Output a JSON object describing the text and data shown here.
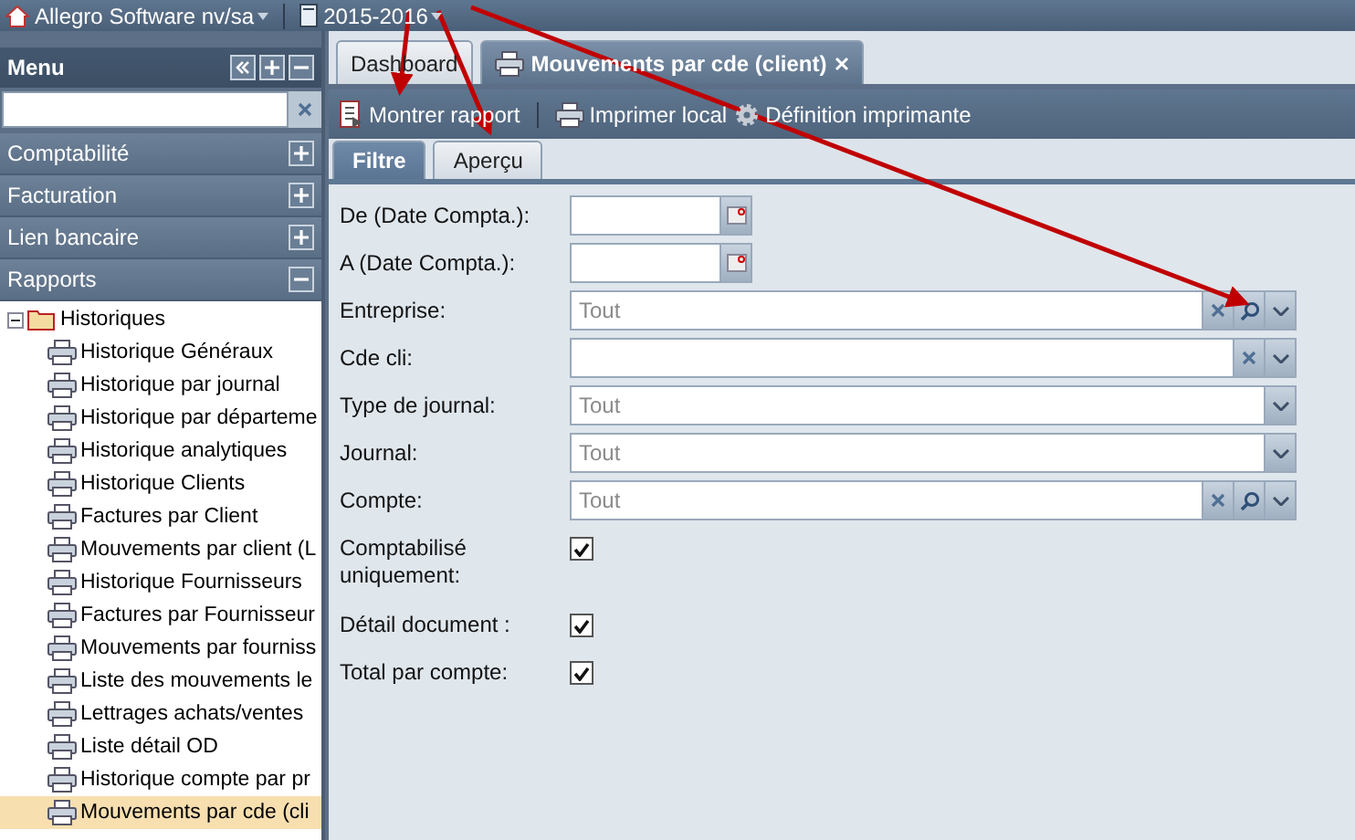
{
  "top_bar": {
    "company": "Allegro Software nv/sa",
    "year": "2015-2016"
  },
  "sidebar": {
    "title": "Menu",
    "sections": [
      {
        "label": "Comptabilité",
        "expanded": false
      },
      {
        "label": "Facturation",
        "expanded": false
      },
      {
        "label": "Lien bancaire",
        "expanded": false
      },
      {
        "label": "Rapports",
        "expanded": true
      }
    ],
    "tree": [
      {
        "label": "Historiques",
        "expanded": true,
        "children": [
          {
            "label": "Historique Généraux",
            "selected": false
          },
          {
            "label": "Historique par journal",
            "selected": false
          },
          {
            "label": "Historique par départeme",
            "selected": false
          },
          {
            "label": "Historique analytiques",
            "selected": false
          },
          {
            "label": "Historique Clients",
            "selected": false
          },
          {
            "label": "Factures par Client",
            "selected": false
          },
          {
            "label": "Mouvements par client (L",
            "selected": false
          },
          {
            "label": "Historique Fournisseurs",
            "selected": false
          },
          {
            "label": "Factures par Fournisseur",
            "selected": false
          },
          {
            "label": "Mouvements par fourniss",
            "selected": false
          },
          {
            "label": "Liste des mouvements le",
            "selected": false
          },
          {
            "label": "Lettrages achats/ventes",
            "selected": false
          },
          {
            "label": "Liste détail OD",
            "selected": false
          },
          {
            "label": "Historique compte par pr",
            "selected": false
          },
          {
            "label": "Mouvements par cde (cli",
            "selected": true
          }
        ]
      }
    ]
  },
  "tabs": [
    {
      "label": "Dashboard",
      "selected": false,
      "closable": false
    },
    {
      "label": "Mouvements par cde (client)",
      "selected": true,
      "closable": true
    }
  ],
  "toolbar": [
    {
      "kind": "report",
      "label": "Montrer rapport"
    },
    {
      "kind": "print",
      "label": "Imprimer local"
    },
    {
      "kind": "gear",
      "label": "Définition imprimante"
    }
  ],
  "subtabs": [
    {
      "label": "Filtre",
      "selected": true
    },
    {
      "label": "Aperçu",
      "selected": false
    }
  ],
  "form": [
    {
      "kind": "date",
      "label": "De (Date Compta.):"
    },
    {
      "kind": "date",
      "label": "A (Date Compta.):"
    },
    {
      "kind": "combo",
      "label": "Entreprise:",
      "placeholder": "Tout",
      "triggers": [
        {
          "kind": "clear"
        },
        {
          "kind": "search"
        },
        {
          "kind": "dropdown"
        }
      ]
    },
    {
      "kind": "combo",
      "label": "Cde cli:",
      "triggers": [
        {
          "kind": "clear"
        },
        {
          "kind": "dropdown"
        }
      ]
    },
    {
      "kind": "combo",
      "label": "Type de journal:",
      "placeholder": "Tout",
      "triggers": [
        {
          "kind": "dropdown"
        }
      ]
    },
    {
      "kind": "combo",
      "label": "Journal:",
      "placeholder": "Tout",
      "triggers": [
        {
          "kind": "dropdown"
        }
      ]
    },
    {
      "kind": "combo",
      "label": "Compte:",
      "placeholder": "Tout",
      "triggers": [
        {
          "kind": "clear"
        },
        {
          "kind": "search"
        },
        {
          "kind": "dropdown"
        }
      ]
    },
    {
      "kind": "check",
      "label": "Comptabilisé uniquement:",
      "checked": true
    },
    {
      "kind": "check",
      "label": "Détail document :",
      "checked": true
    },
    {
      "kind": "check",
      "label": "Total par compte:",
      "checked": true
    }
  ]
}
